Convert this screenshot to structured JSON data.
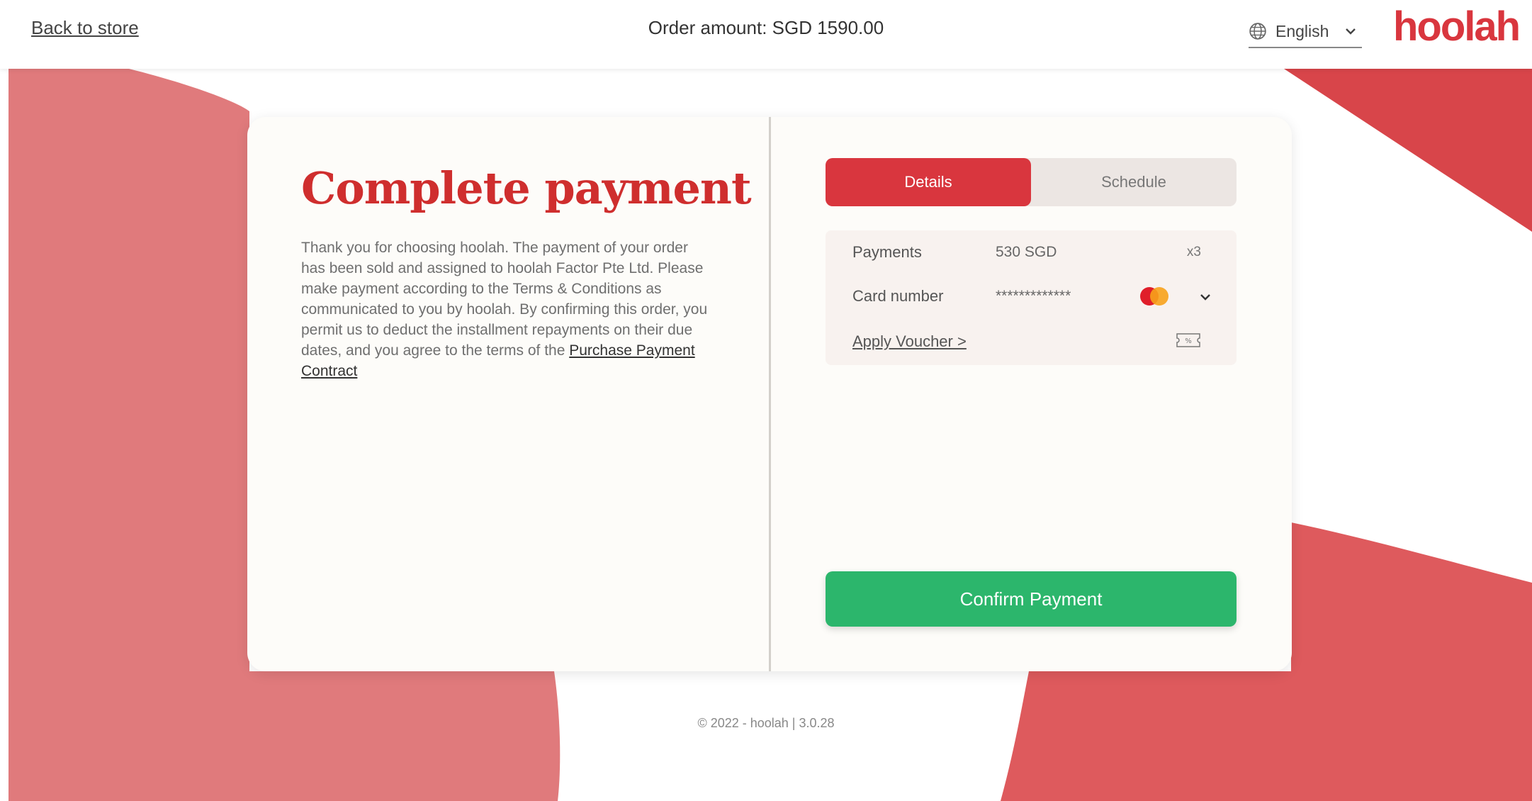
{
  "header": {
    "back_link": "Back to store",
    "order_amount": "Order amount: SGD 1590.00",
    "language": "English",
    "logo": "hoolah"
  },
  "main": {
    "title": "Complete payment",
    "description": "Thank you for choosing hoolah. The payment of your order has been sold and assigned to hoolah Factor Pte Ltd. Please make payment according to the Terms & Conditions as communicated to you by hoolah. By confirming this order, you permit us to deduct the installment repayments on their due dates, and you agree to the terms of the ",
    "contract_link": "Purchase Payment Contract"
  },
  "tabs": [
    {
      "label": "Details",
      "active": true
    },
    {
      "label": "Schedule",
      "active": false
    }
  ],
  "details": {
    "payments_label": "Payments",
    "payments_value": "530 SGD",
    "payments_count": "x3",
    "card_label": "Card number",
    "card_value": "*************",
    "card_brand_icon": "mastercard-icon",
    "voucher_label": "Apply Voucher >"
  },
  "confirm_label": "Confirm Payment",
  "footer": "© 2022 - hoolah | 3.0.28",
  "colors": {
    "brand_red": "#d9363e",
    "title_red": "#cf2e2e",
    "confirm_green": "#2cb66c",
    "bg_red_light": "#e07a7c",
    "bg_red": "#de5a5d"
  }
}
